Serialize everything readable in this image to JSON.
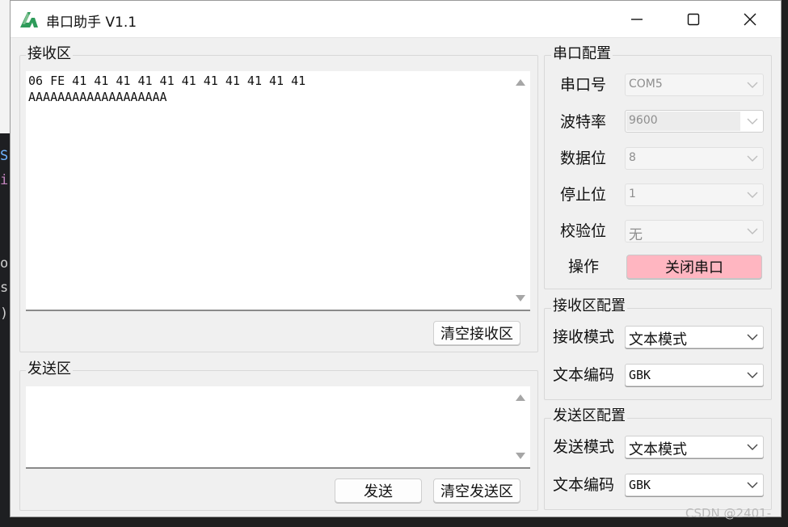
{
  "window": {
    "title": "串口助手 V1.1"
  },
  "editor_bg_chars": [
    "S",
    "i",
    "o",
    "s",
    ")"
  ],
  "receive": {
    "group_title": "接收区",
    "content_lines": [
      "06 FE 41 41 41 41 41 41 41 41 41 41 41",
      "AAAAAAAAAAAAAAAAAAA"
    ],
    "clear_button": "清空接收区"
  },
  "send": {
    "group_title": "发送区",
    "content": "",
    "send_button": "发送",
    "clear_button": "清空发送区"
  },
  "serial_config": {
    "group_title": "串口配置",
    "rows": [
      {
        "label": "串口号",
        "value": "COM5"
      },
      {
        "label": "波特率",
        "value": "9600"
      },
      {
        "label": "数据位",
        "value": "8"
      },
      {
        "label": "停止位",
        "value": "1"
      },
      {
        "label": "校验位",
        "value": "无"
      }
    ],
    "operation_label": "操作",
    "operation_button": "关闭串口"
  },
  "receive_config": {
    "group_title": "接收区配置",
    "mode_label": "接收模式",
    "mode_value": "文本模式",
    "encoding_label": "文本编码",
    "encoding_value": "GBK"
  },
  "send_config": {
    "group_title": "发送区配置",
    "mode_label": "发送模式",
    "mode_value": "文本模式",
    "encoding_label": "文本编码",
    "encoding_value": "GBK"
  },
  "watermark": "CSDN @2401-",
  "colors": {
    "window_bg": "#f0f0f0",
    "button_pink": "#ffb6c1",
    "app_icon_green": "#2e9b5a"
  }
}
